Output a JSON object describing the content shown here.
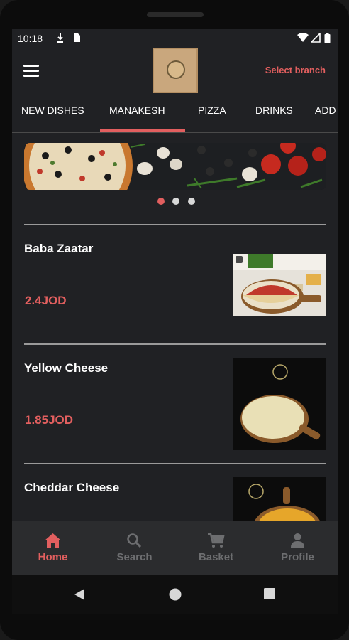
{
  "status_bar": {
    "time": "10:18"
  },
  "header": {
    "logo_icon": "restaurant-logo",
    "menu_icon": "hamburger-menu-icon",
    "branch_label": "Select branch"
  },
  "tabs": [
    {
      "label": "NEW DISHES",
      "active": false
    },
    {
      "label": "MANAKESH",
      "active": true
    },
    {
      "label": "PIZZA",
      "active": false
    },
    {
      "label": "DRINKS",
      "active": false
    },
    {
      "label": "ADD",
      "active": false
    }
  ],
  "banner": {
    "slides": 3,
    "active_slide": 1
  },
  "products": [
    {
      "name": "Baba Zaatar",
      "price": "2.4JOD"
    },
    {
      "name": "Yellow Cheese",
      "price": "1.85JOD"
    },
    {
      "name": "Cheddar Cheese",
      "price": ""
    }
  ],
  "bottom_nav": [
    {
      "label": "Home",
      "icon": "home-icon",
      "active": true
    },
    {
      "label": "Search",
      "icon": "search-icon",
      "active": false
    },
    {
      "label": "Basket",
      "icon": "cart-icon",
      "active": false
    },
    {
      "label": "Profile",
      "icon": "person-icon",
      "active": false
    }
  ],
  "colors": {
    "accent": "#e25f5f",
    "background": "#202124",
    "nav_background": "#2b2c2e",
    "inactive": "#6d6e70"
  }
}
